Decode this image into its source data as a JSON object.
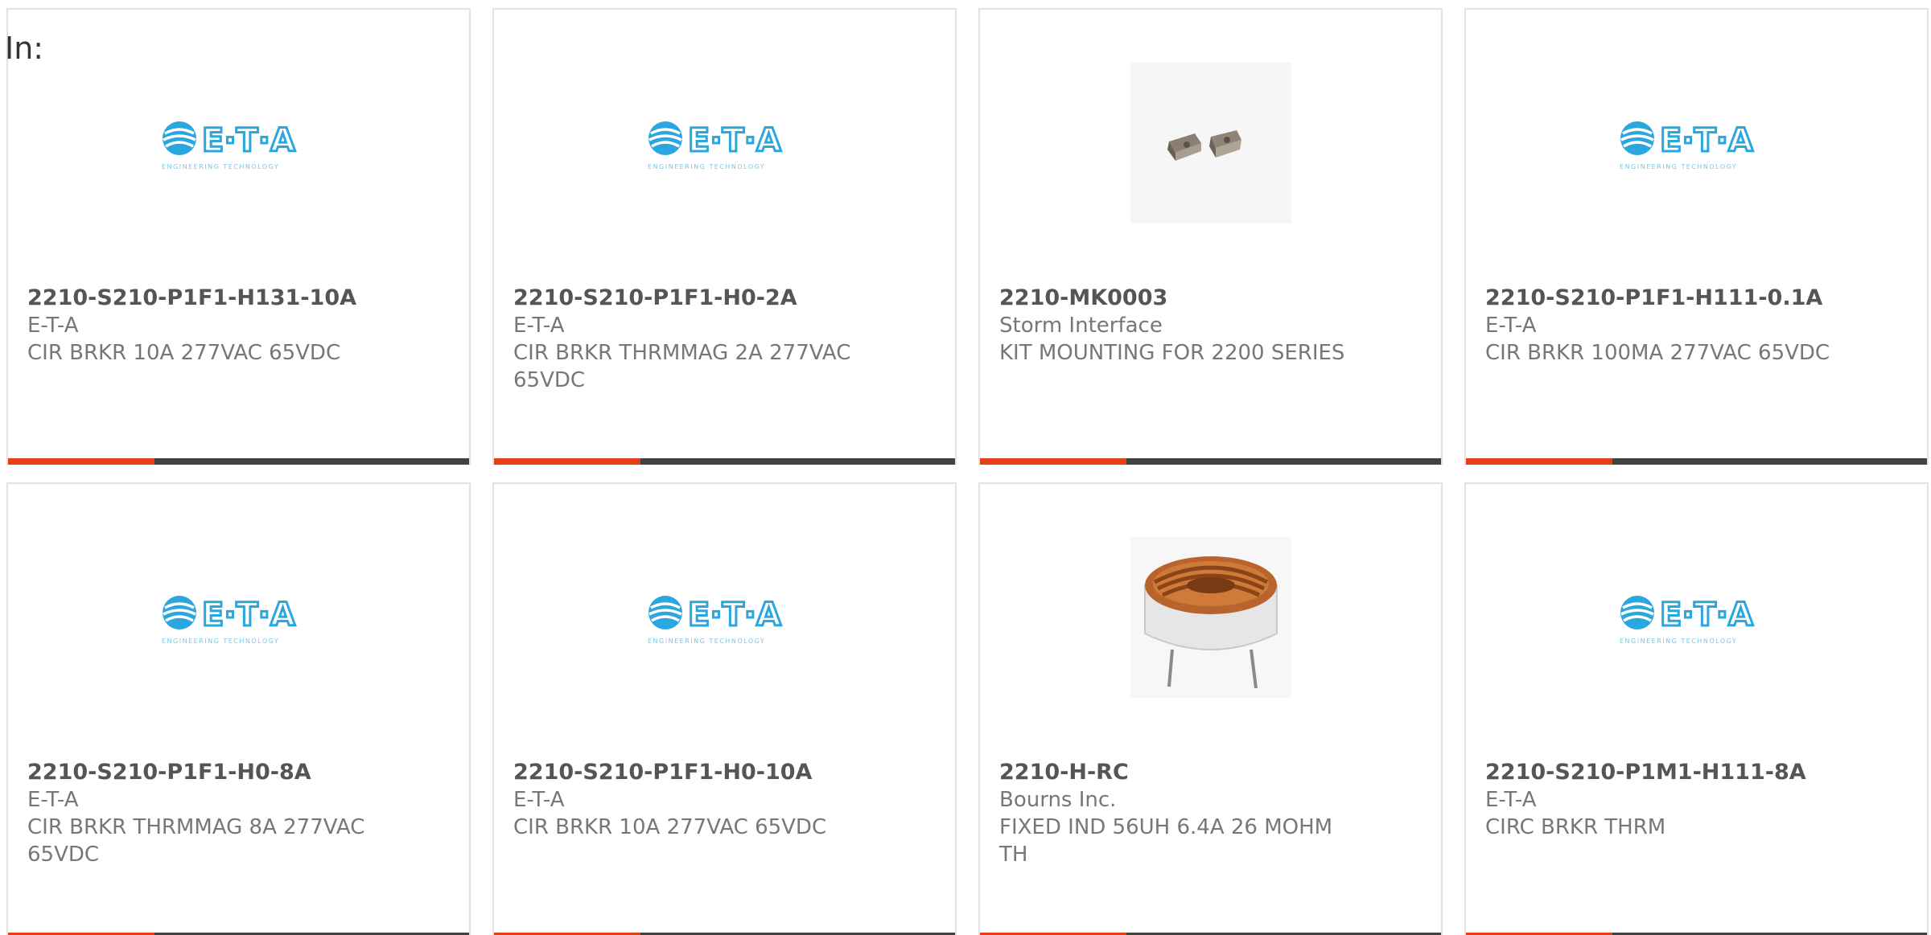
{
  "filter_label": "In:",
  "products": [
    {
      "part_number": "2210-S210-P1F1-H131-10A",
      "manufacturer": "E-T-A",
      "description": "CIR BRKR 10A 277VAC 65VDC",
      "image": "eta-logo"
    },
    {
      "part_number": "2210-S210-P1F1-H0-2A",
      "manufacturer": "E-T-A",
      "description": "CIR BRKR THRMMAG 2A 277VAC 65VDC",
      "image": "eta-logo"
    },
    {
      "part_number": "2210-MK0003",
      "manufacturer": "Storm Interface",
      "description": "KIT MOUNTING FOR 2200 SERIES",
      "image": "mounting-kit-photo"
    },
    {
      "part_number": "2210-S210-P1F1-H111-0.1A",
      "manufacturer": "E-T-A",
      "description": "CIR BRKR 100MA 277VAC 65VDC",
      "image": "eta-logo"
    },
    {
      "part_number": "2210-S210-P1F1-H0-8A",
      "manufacturer": "E-T-A",
      "description": "CIR BRKR THRMMAG 8A 277VAC 65VDC",
      "image": "eta-logo"
    },
    {
      "part_number": "2210-S210-P1F1-H0-10A",
      "manufacturer": "E-T-A",
      "description": "CIR BRKR 10A 277VAC 65VDC",
      "image": "eta-logo"
    },
    {
      "part_number": "2210-H-RC",
      "manufacturer": "Bourns Inc.",
      "description": "FIXED IND 56UH 6.4A 26 MOHM TH",
      "image": "toroid-inductor-photo"
    },
    {
      "part_number": "2210-S210-P1M1-H111-8A",
      "manufacturer": "E-T-A",
      "description": "CIRC BRKR THRM",
      "image": "eta-logo"
    }
  ],
  "logo": {
    "text": "E·T·A",
    "tagline": "ENGINEERING TECHNOLOGY"
  },
  "colors": {
    "accent": "#e53f14",
    "bar": "#414141",
    "logo_blue": "#2aa7df",
    "text_muted": "#777777",
    "text_strong": "#555555"
  }
}
